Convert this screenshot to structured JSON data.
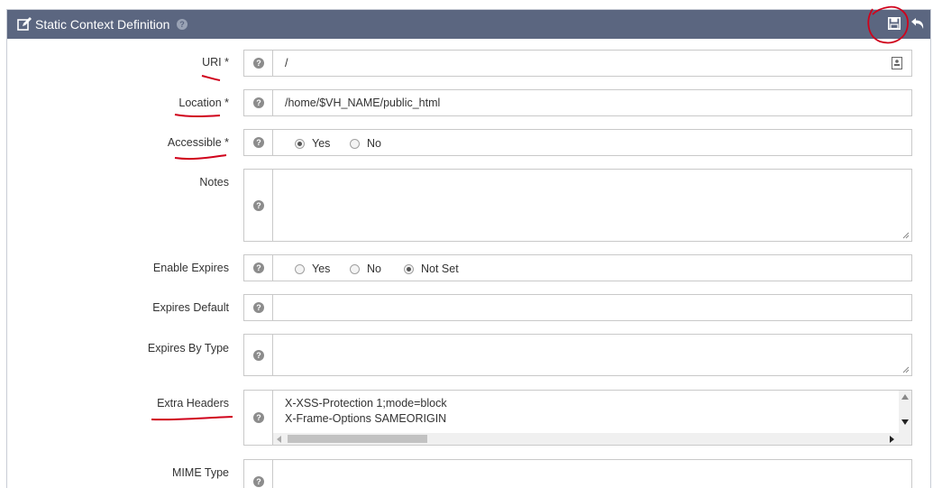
{
  "header": {
    "title": "Static Context Definition",
    "help_icon": "question-circle-icon",
    "actions": [
      "save-icon",
      "undo-icon"
    ]
  },
  "fields": {
    "uri": {
      "label": "URI *",
      "value": "/"
    },
    "location": {
      "label": "Location *",
      "value": "/home/$VH_NAME/public_html"
    },
    "accessible": {
      "label": "Accessible *",
      "options": [
        "Yes",
        "No"
      ],
      "selected": "Yes"
    },
    "notes": {
      "label": "Notes",
      "value": ""
    },
    "enable_expires": {
      "label": "Enable Expires",
      "options": [
        "Yes",
        "No",
        "Not Set"
      ],
      "selected": "Not Set"
    },
    "expires_default": {
      "label": "Expires Default",
      "value": ""
    },
    "expires_by_type": {
      "label": "Expires By Type",
      "value": ""
    },
    "extra_headers": {
      "label": "Extra Headers",
      "lines": [
        "X-XSS-Protection 1;mode=block",
        "X-Frame-Options SAMEORIGIN"
      ]
    },
    "mime_type": {
      "label": "MIME Type",
      "value": ""
    }
  },
  "colors": {
    "header_bg": "#5b6680",
    "annotation": "#d0021b"
  }
}
